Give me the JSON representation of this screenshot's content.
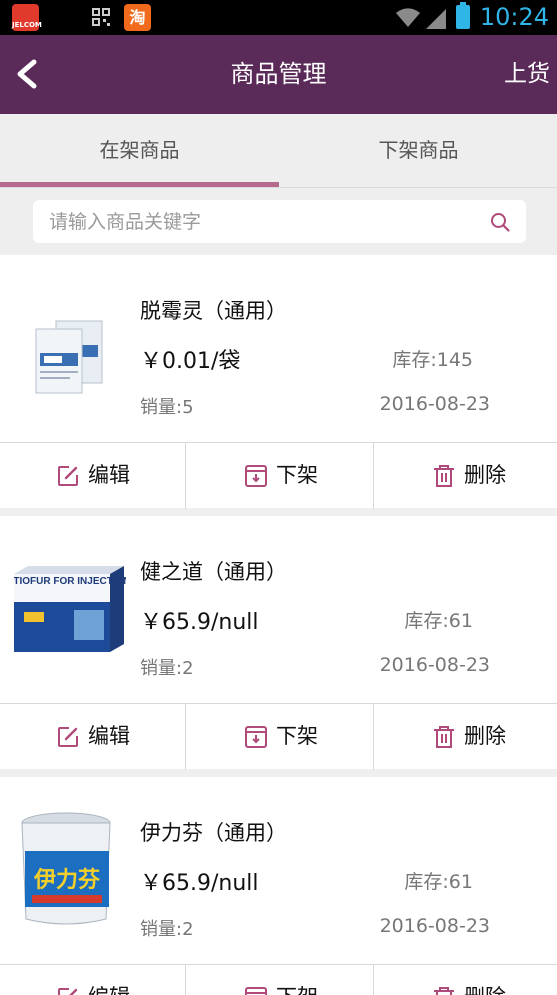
{
  "status_bar": {
    "time": "10:24",
    "app_icons": [
      "jelcom-app-icon",
      "qr-scanner-icon",
      "taobao-app-icon"
    ],
    "app1_text": "JELCOM",
    "app3_text": "淘",
    "accent_color": "#2fb5e6"
  },
  "header": {
    "title": "商品管理",
    "right_action": "上货",
    "back_icon": "chevron-left-icon",
    "background": "#5a2a58"
  },
  "tabs": [
    {
      "label": "在架商品",
      "selected": true
    },
    {
      "label": "下架商品",
      "selected": false
    }
  ],
  "search": {
    "placeholder": "请输入商品关键字",
    "value": ""
  },
  "products": [
    {
      "name": "脱霉灵（通用）",
      "price": "￥0.01/袋",
      "stock": "库存:145",
      "sales": "销量:5",
      "date": "2016-08-23",
      "image": "product-bag-icon"
    },
    {
      "name": "健之道（通用）",
      "price": "￥65.9/null",
      "stock": "库存:61",
      "sales": "销量:2",
      "date": "2016-08-23",
      "image": "product-box-icon",
      "box_text": "CEFTIOFUR FOR INJECTION"
    },
    {
      "name": "伊力芬（通用）",
      "price": "￥65.9/null",
      "stock": "库存:61",
      "sales": "销量:2",
      "date": "2016-08-23",
      "image": "product-bucket-icon",
      "bucket_text": "伊力芬"
    }
  ],
  "actions": {
    "edit": "编辑",
    "unshelve": "下架",
    "delete": "删除",
    "icon_color": "#b04a7a"
  }
}
